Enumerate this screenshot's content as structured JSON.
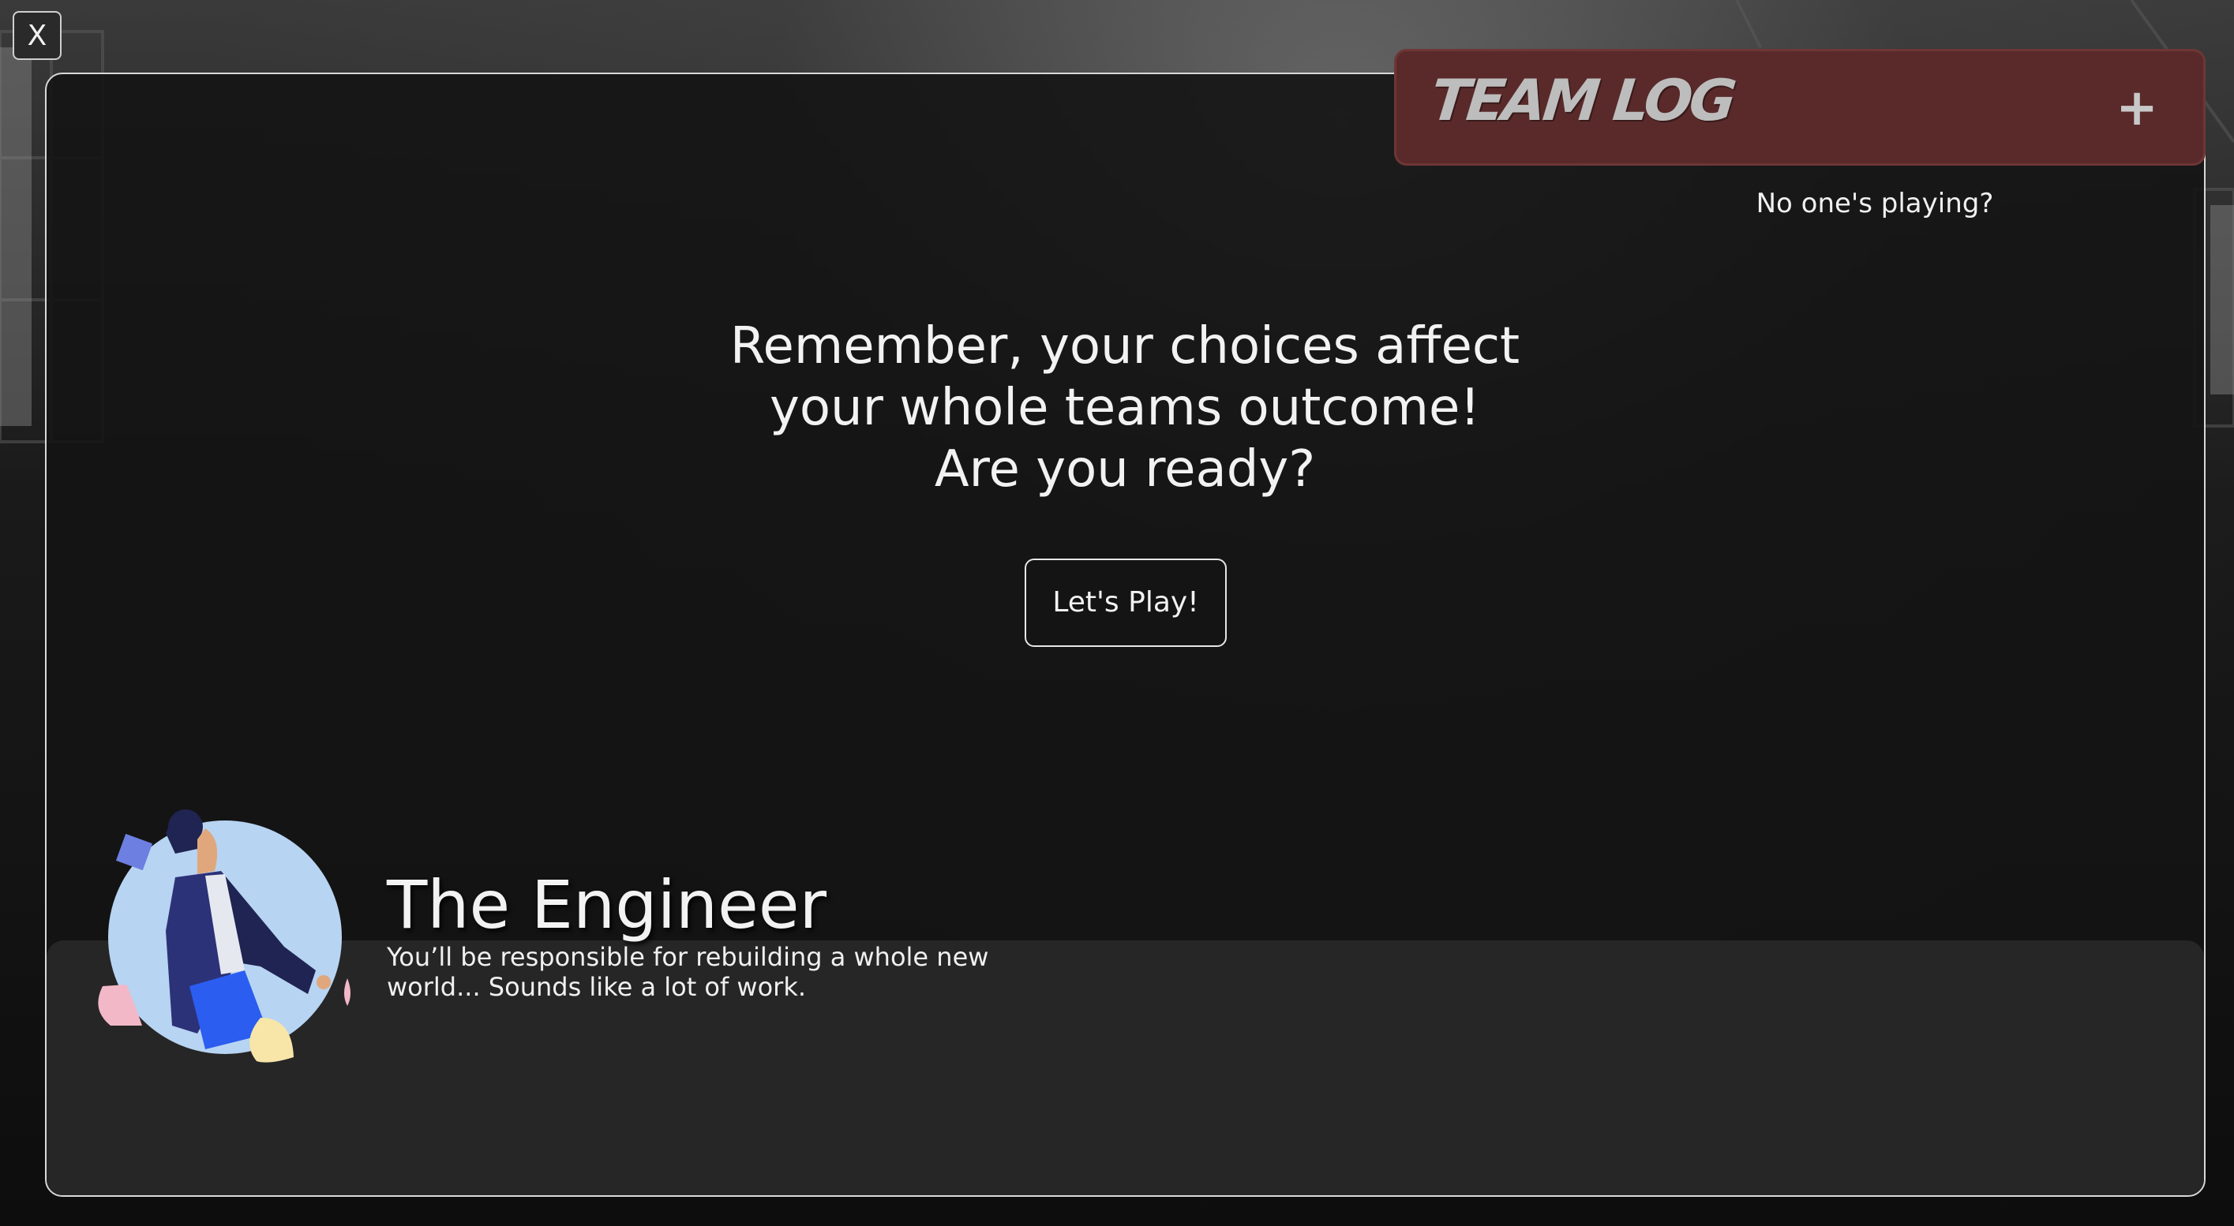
{
  "window": {
    "close_label": "X"
  },
  "team_log": {
    "title": "TEAM LOG",
    "add_label": "+",
    "empty_text": "No one's playing?",
    "color": "#5a2a2a"
  },
  "intro": {
    "line1": "Remember, your choices affect",
    "line2": "your whole teams outcome!",
    "line3": "Are you ready?"
  },
  "play_button": {
    "label": "Let's Play!"
  },
  "role": {
    "name": "The Engineer",
    "description": "You’ll be responsible for rebuilding a whole new world... Sounds like a lot of work.",
    "avatar_icon": "engineer-character-icon"
  }
}
